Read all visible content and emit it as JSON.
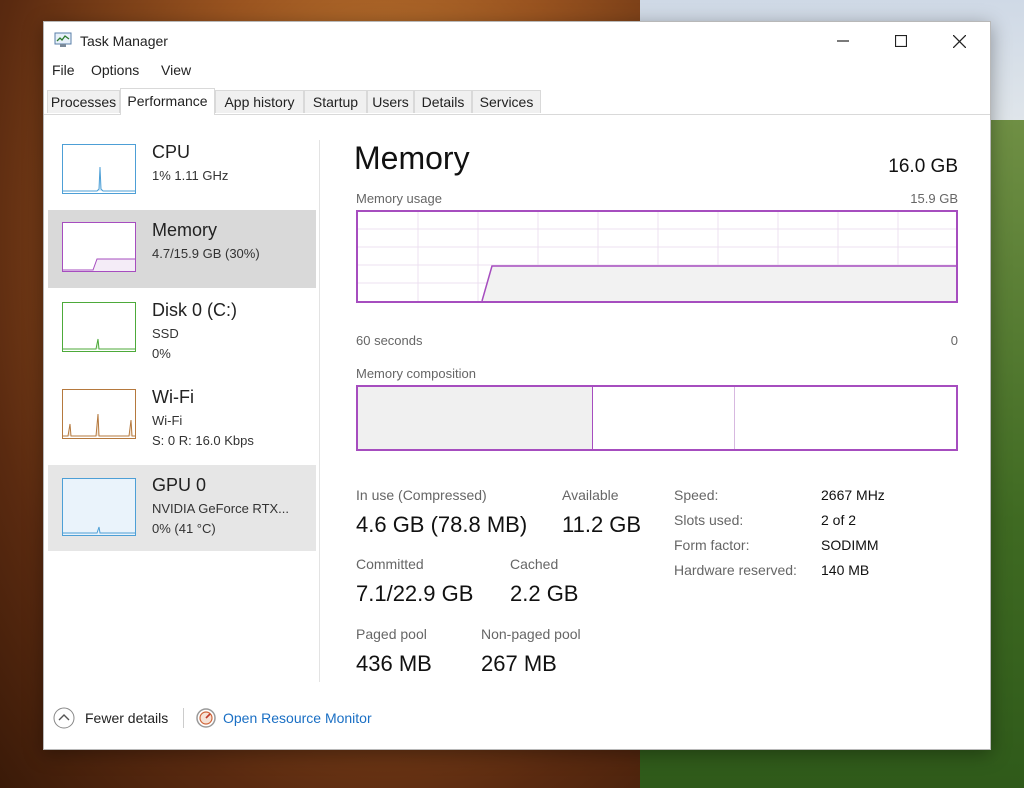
{
  "window": {
    "title": "Task Manager"
  },
  "menu": [
    "File",
    "Options",
    "View"
  ],
  "tabs": [
    "Processes",
    "Performance",
    "App history",
    "Startup",
    "Users",
    "Details",
    "Services"
  ],
  "active_tab": "Performance",
  "sidebar": [
    {
      "title": "CPU",
      "line2": "1% 1.11 GHz",
      "line3": "",
      "color": "#4d9fd6"
    },
    {
      "title": "Memory",
      "line2": "4.7/15.9 GB (30%)",
      "line3": "",
      "color": "#a64dbf",
      "selected": true
    },
    {
      "title": "Disk 0 (C:)",
      "line2": "SSD",
      "line3": "0%",
      "color": "#4daa3a"
    },
    {
      "title": "Wi-Fi",
      "line2": "Wi-Fi",
      "line3": "S: 0 R: 16.0 Kbps",
      "color": "#b5793e"
    },
    {
      "title": "GPU 0",
      "line2": "NVIDIA GeForce RTX...",
      "line3": "0% (41 °C)",
      "color": "#4d9fd6"
    }
  ],
  "main": {
    "title": "Memory",
    "total": "16.0 GB",
    "usage_label": "Memory usage",
    "usage_max": "15.9 GB",
    "time_left": "60 seconds",
    "time_right": "0",
    "composition_label": "Memory composition"
  },
  "stats": {
    "in_use_label": "In use (Compressed)",
    "in_use_value": "4.6 GB (78.8 MB)",
    "available_label": "Available",
    "available_value": "11.2 GB",
    "committed_label": "Committed",
    "committed_value": "7.1/22.9 GB",
    "cached_label": "Cached",
    "cached_value": "2.2 GB",
    "paged_label": "Paged pool",
    "paged_value": "436 MB",
    "nonpaged_label": "Non-paged pool",
    "nonpaged_value": "267 MB"
  },
  "specs": [
    {
      "label": "Speed:",
      "value": "2667 MHz"
    },
    {
      "label": "Slots used:",
      "value": "2 of 2"
    },
    {
      "label": "Form factor:",
      "value": "SODIMM"
    },
    {
      "label": "Hardware reserved:",
      "value": "140 MB"
    }
  ],
  "footer": {
    "fewer": "Fewer details",
    "resource_monitor": "Open Resource Monitor"
  },
  "colors": {
    "memory": "#a64dbf",
    "link": "#1a6fc4"
  }
}
